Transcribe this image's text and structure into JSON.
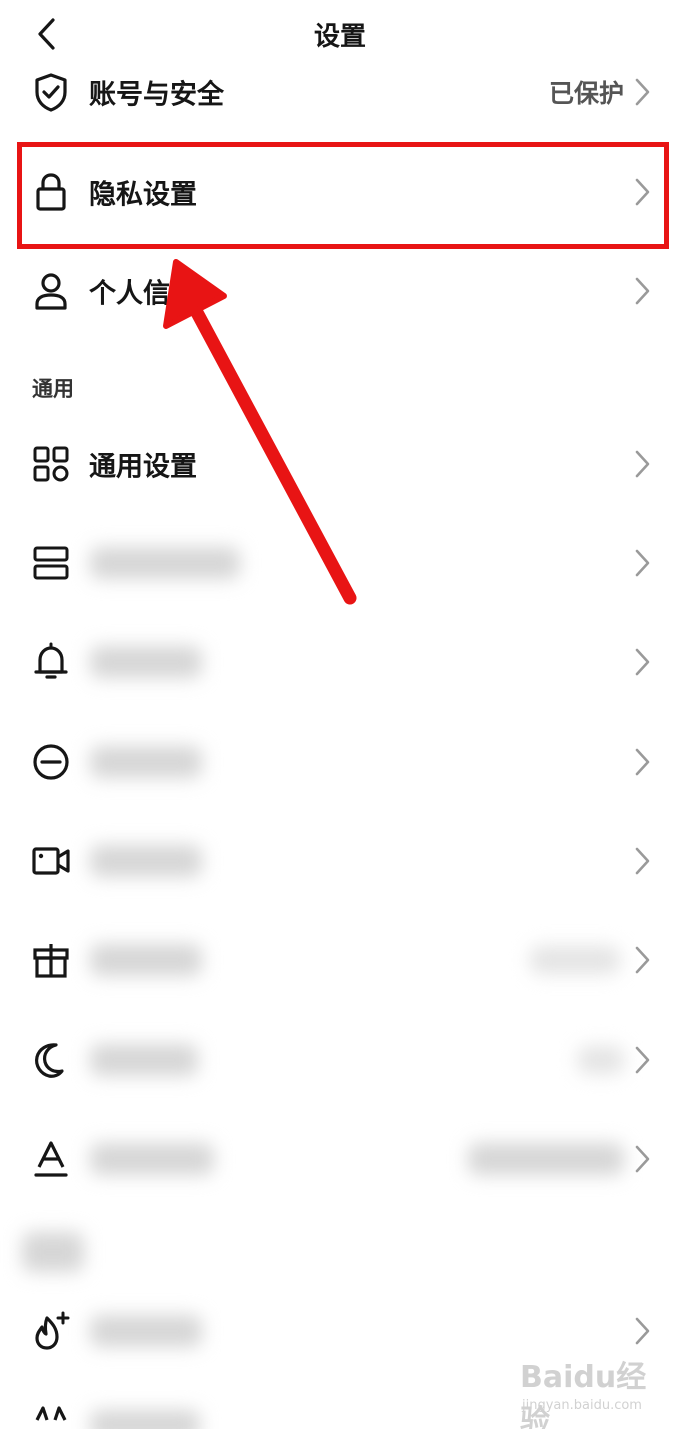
{
  "header": {
    "title": "设置"
  },
  "account_section": {
    "items": [
      {
        "label": "账号与安全",
        "value": "已保护",
        "icon": "shield-check-icon"
      },
      {
        "label": "隐私设置",
        "icon": "lock-icon"
      },
      {
        "label": "个人信",
        "icon": "person-icon"
      }
    ]
  },
  "general_section": {
    "title": "通用",
    "items": [
      {
        "label": "通用设置",
        "icon": "grid-icon"
      },
      {
        "label": "",
        "icon": "storage-icon"
      },
      {
        "label": "",
        "icon": "bell-icon"
      },
      {
        "label": "",
        "icon": "minus-circle-icon"
      },
      {
        "label": "",
        "icon": "video-camera-icon"
      },
      {
        "label": "",
        "icon": "gift-icon"
      },
      {
        "label": "",
        "icon": "moon-icon"
      },
      {
        "label": "",
        "icon": "font-size-icon"
      }
    ]
  },
  "bottom_section": {
    "items": [
      {
        "label": "",
        "icon": "flame-plus-icon"
      },
      {
        "label": "",
        "icon": "sparkle-icon"
      }
    ]
  },
  "annotation": {
    "color": "#e81414"
  },
  "watermark": {
    "brand": "Baidu经验",
    "url": "jingyan.baidu.com"
  }
}
